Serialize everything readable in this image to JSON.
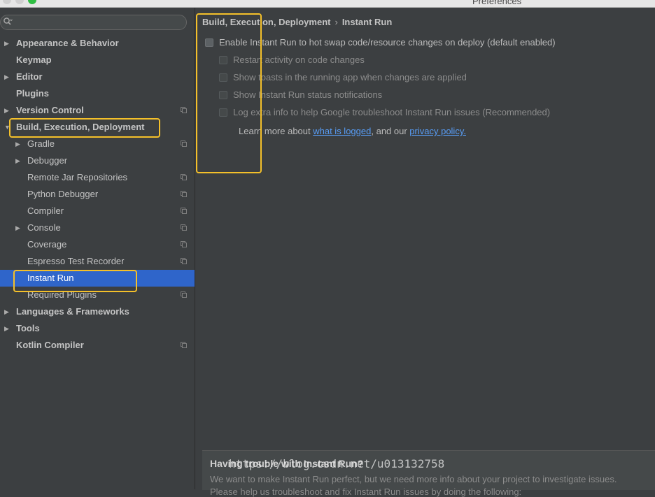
{
  "window": {
    "title": "Preferences"
  },
  "sidebar": {
    "search_placeholder": "",
    "items": [
      {
        "label": "Appearance & Behavior",
        "level": 0,
        "arrow": "collapsed",
        "bold": true,
        "copy": false
      },
      {
        "label": "Keymap",
        "level": 0,
        "arrow": "none",
        "bold": true,
        "copy": false
      },
      {
        "label": "Editor",
        "level": 0,
        "arrow": "collapsed",
        "bold": true,
        "copy": false
      },
      {
        "label": "Plugins",
        "level": 0,
        "arrow": "none",
        "bold": true,
        "copy": false
      },
      {
        "label": "Version Control",
        "level": 0,
        "arrow": "collapsed",
        "bold": true,
        "copy": true
      },
      {
        "label": "Build, Execution, Deployment",
        "level": 0,
        "arrow": "expanded",
        "bold": true,
        "copy": false
      },
      {
        "label": "Gradle",
        "level": 1,
        "arrow": "collapsed",
        "bold": false,
        "copy": true
      },
      {
        "label": "Debugger",
        "level": 1,
        "arrow": "collapsed",
        "bold": false,
        "copy": false
      },
      {
        "label": "Remote Jar Repositories",
        "level": 1,
        "arrow": "none",
        "bold": false,
        "copy": true
      },
      {
        "label": "Python Debugger",
        "level": 1,
        "arrow": "none",
        "bold": false,
        "copy": true
      },
      {
        "label": "Compiler",
        "level": 1,
        "arrow": "none",
        "bold": false,
        "copy": true
      },
      {
        "label": "Console",
        "level": 1,
        "arrow": "collapsed",
        "bold": false,
        "copy": true
      },
      {
        "label": "Coverage",
        "level": 1,
        "arrow": "none",
        "bold": false,
        "copy": true
      },
      {
        "label": "Espresso Test Recorder",
        "level": 1,
        "arrow": "none",
        "bold": false,
        "copy": true
      },
      {
        "label": "Instant Run",
        "level": 1,
        "arrow": "none",
        "bold": false,
        "copy": false,
        "selected": true
      },
      {
        "label": "Required Plugins",
        "level": 1,
        "arrow": "none",
        "bold": false,
        "copy": true
      },
      {
        "label": "Languages & Frameworks",
        "level": 0,
        "arrow": "collapsed",
        "bold": true,
        "copy": false
      },
      {
        "label": "Tools",
        "level": 0,
        "arrow": "collapsed",
        "bold": true,
        "copy": false
      },
      {
        "label": "Kotlin Compiler",
        "level": 0,
        "arrow": "none",
        "bold": true,
        "copy": true
      }
    ]
  },
  "breadcrumb": {
    "parent": "Build, Execution, Deployment",
    "separator": "›",
    "current": "Instant Run"
  },
  "options": {
    "enable": {
      "label": "Enable Instant Run to hot swap code/resource changes on deploy (default enabled)",
      "checked": false
    },
    "restart": {
      "label": "Restart activity on code changes",
      "checked": false
    },
    "toasts": {
      "label": "Show toasts in the running app when changes are applied",
      "checked": false
    },
    "notifications": {
      "label": "Show Instant Run status notifications",
      "checked": false
    },
    "log": {
      "label": "Log extra info to help Google troubleshoot Instant Run issues (Recommended)",
      "checked": false
    }
  },
  "learn": {
    "prefix": "Learn more about ",
    "link1": "what is logged",
    "middle": ", and our ",
    "link2": "privacy policy."
  },
  "trouble": {
    "title": "Having trouble with Instant Run?",
    "body": "We want to make Instant Run perfect, but we need more info about your project to investigate issues.",
    "body2": "Please help us troubleshoot and fix Instant Run issues by doing the following:"
  },
  "watermark": "https://blog.csdn.net/u013132758",
  "colors": {
    "selection": "#2f65ca",
    "highlight": "#f4c02a",
    "link": "#589df6",
    "background": "#3c3f41"
  }
}
